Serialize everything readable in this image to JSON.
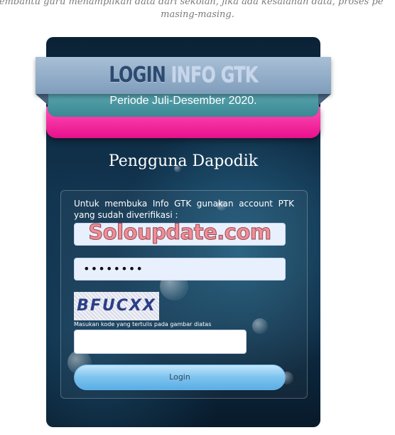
{
  "intro": {
    "line1": "membantu guru menampilkan data dari sekolah, jika ada kesalahan data, proses pe",
    "line2": "masing-masing."
  },
  "header": {
    "logo_bold": "LOGIN",
    "logo_light": "INFO GTK",
    "period": "Periode Juli-Desember 2020."
  },
  "heading": "Pengguna Dapodik",
  "form": {
    "instruction": "Untuk membuka Info GTK gunakan account PTK yang sudah diverifikasi :",
    "username_watermark": "Soloupdate.com",
    "password_value": "••••••••",
    "captcha_text": "BFUCXX",
    "captcha_label": "Masukan kode yang tertulis pada gambar diatas",
    "login_label": "Login"
  },
  "colors": {
    "panel": "#0e2c44",
    "pink_band": "#e8108c",
    "teal_band": "#3a8893",
    "button": "#7dc3ef"
  }
}
